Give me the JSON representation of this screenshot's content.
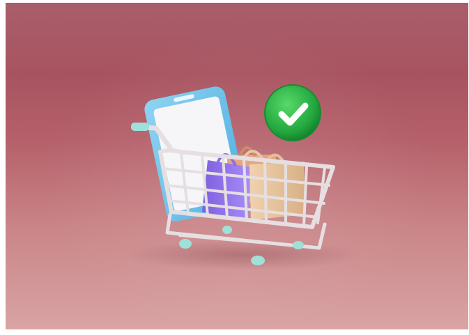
{
  "image": {
    "subject": "shopping-cart-with-phone-and-bags",
    "palette": {
      "background_top": "#a85460",
      "background_bottom": "#d9a4a4",
      "phone_body": "#6fc3ea",
      "phone_screen": "#f4f4f6",
      "bag_purple": "#9b7bf0",
      "bag_tan": "#e8c7a0",
      "bag_orange": "#e7a47e",
      "cart_metal": "#ddd6d8",
      "wheel": "#9fe0d8",
      "badge_green": "#2db34a",
      "check_white": "#ffffff"
    },
    "icons": [
      "shopping-cart-icon",
      "smartphone-icon",
      "shopping-bag-icon",
      "check-badge-icon"
    ]
  }
}
